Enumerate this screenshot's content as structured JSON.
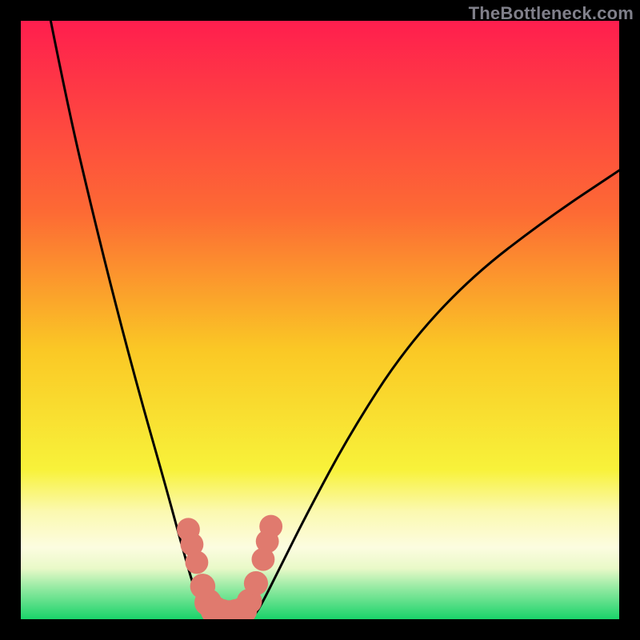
{
  "watermark": "TheBottleneck.com",
  "chart_data": {
    "type": "line",
    "title": "",
    "xlabel": "",
    "ylabel": "",
    "xlim": [
      0,
      100
    ],
    "ylim": [
      0,
      100
    ],
    "gradient_stops": [
      {
        "offset": 0,
        "color": "#ff1e4e"
      },
      {
        "offset": 0.32,
        "color": "#fd6a34"
      },
      {
        "offset": 0.55,
        "color": "#fac825"
      },
      {
        "offset": 0.75,
        "color": "#f8f23a"
      },
      {
        "offset": 0.82,
        "color": "#fbf9b0"
      },
      {
        "offset": 0.88,
        "color": "#fcfce0"
      },
      {
        "offset": 0.915,
        "color": "#e9f9c8"
      },
      {
        "offset": 0.95,
        "color": "#8fe9a0"
      },
      {
        "offset": 1.0,
        "color": "#19d36a"
      }
    ],
    "series": [
      {
        "name": "left-branch",
        "x": [
          5,
          8,
          12,
          16,
          20,
          24,
          27,
          29,
          30.5,
          31.5
        ],
        "y": [
          100,
          85,
          68,
          52,
          37,
          23,
          12,
          5,
          1.5,
          0
        ]
      },
      {
        "name": "valley-floor",
        "x": [
          31.5,
          33,
          35,
          37,
          38.5
        ],
        "y": [
          0,
          0,
          0,
          0,
          0
        ]
      },
      {
        "name": "right-branch",
        "x": [
          38.5,
          40,
          43,
          48,
          55,
          64,
          75,
          88,
          100
        ],
        "y": [
          0,
          2,
          8,
          18,
          31,
          45,
          57,
          67,
          75
        ]
      }
    ],
    "markers": {
      "name": "salmon-dots",
      "color": "#e07a6e",
      "points": [
        {
          "x": 28.0,
          "y": 15.0,
          "r": 1.4
        },
        {
          "x": 28.6,
          "y": 12.5,
          "r": 1.4
        },
        {
          "x": 29.4,
          "y": 9.5,
          "r": 1.4
        },
        {
          "x": 30.4,
          "y": 5.5,
          "r": 1.6
        },
        {
          "x": 31.3,
          "y": 2.8,
          "r": 1.8
        },
        {
          "x": 32.4,
          "y": 1.5,
          "r": 1.9
        },
        {
          "x": 33.6,
          "y": 1.0,
          "r": 1.9
        },
        {
          "x": 34.8,
          "y": 0.8,
          "r": 1.9
        },
        {
          "x": 36.0,
          "y": 1.0,
          "r": 1.9
        },
        {
          "x": 37.2,
          "y": 1.5,
          "r": 1.8
        },
        {
          "x": 38.2,
          "y": 3.0,
          "r": 1.6
        },
        {
          "x": 39.3,
          "y": 6.0,
          "r": 1.5
        },
        {
          "x": 40.5,
          "y": 10.0,
          "r": 1.4
        },
        {
          "x": 41.2,
          "y": 13.0,
          "r": 1.4
        },
        {
          "x": 41.8,
          "y": 15.5,
          "r": 1.4
        }
      ]
    }
  }
}
